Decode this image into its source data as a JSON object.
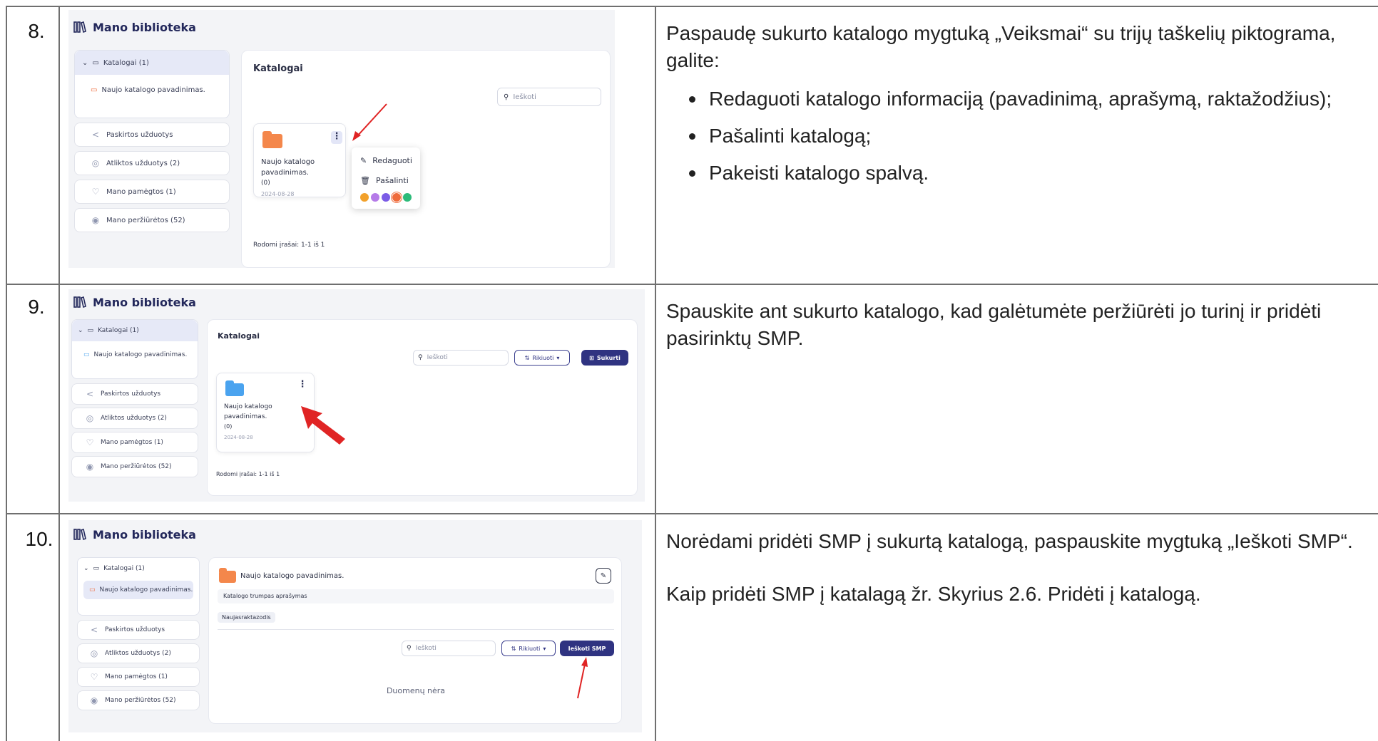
{
  "rows": [
    {
      "number": "8.",
      "description": {
        "intro": "Paspaudę sukurto katalogo mygtuką „Veiksmai“ su trijų taškelių piktograma, galite:",
        "bullets": [
          "Redaguoti katalogo informaciją (pavadinimą, aprašymą, raktažodžius);",
          "Pašalinti katalogą;",
          "Pakeisti katalogo spalvą."
        ]
      }
    },
    {
      "number": "9.",
      "description": {
        "intro": "Spauskite ant sukurto katalogo, kad galėtumėte peržiūrėti jo turinį ir pridėti pasirinktų SMP."
      }
    },
    {
      "number": "10.",
      "description": {
        "intro": "Norėdami pridėti SMP į sukurtą katalogą, paspauskite mygtuką „Ieškoti SMP“.",
        "note": "Kaip pridėti SMP į katalagą žr. Skyrius 2.6. Pridėti į katalogą."
      }
    }
  ],
  "ui": {
    "library_title": "Mano biblioteka",
    "sidebar": {
      "catalogs": "Katalogai  (1)",
      "catalog_item": "Naujo katalogo pavadinimas.",
      "assigned": "Paskirtos užduotys",
      "completed": "Atliktos užduotys  (2)",
      "liked": "Mano pamėgtos  (1)",
      "viewed": "Mano peržiūrėtos  (52)"
    },
    "panel_title": "Katalogai",
    "search_placeholder": "Ieškoti",
    "sort_label": "Rikiuoti",
    "create_label": "Sukurti",
    "card": {
      "name_line1": "Naujo katalogo",
      "name_line2": "pavadinimas.",
      "count": "(0)",
      "date": "2024-08-28"
    },
    "records": "Rodomi įrašai: 1-1 iš 1",
    "menu": {
      "edit": "Redaguoti",
      "delete": "Pašalinti",
      "colors": [
        "#f2a12b",
        "#b57be8",
        "#7b5ce6",
        "#ef6b3b",
        "#2dbb7a"
      ]
    },
    "catalog_view": {
      "title": "Naujo katalogo pavadinimas.",
      "short_description": "Katalogo trumpas aprašymas",
      "keyword": "Naujasraktazodis",
      "search_smp": "Ieškoti SMP",
      "no_data": "Duomenų nėra"
    }
  },
  "colors": {
    "accent": "#2f3381",
    "folder_orange": "#f4874b",
    "folder_blue": "#4aa3ef",
    "arrow_red": "#e02424"
  }
}
